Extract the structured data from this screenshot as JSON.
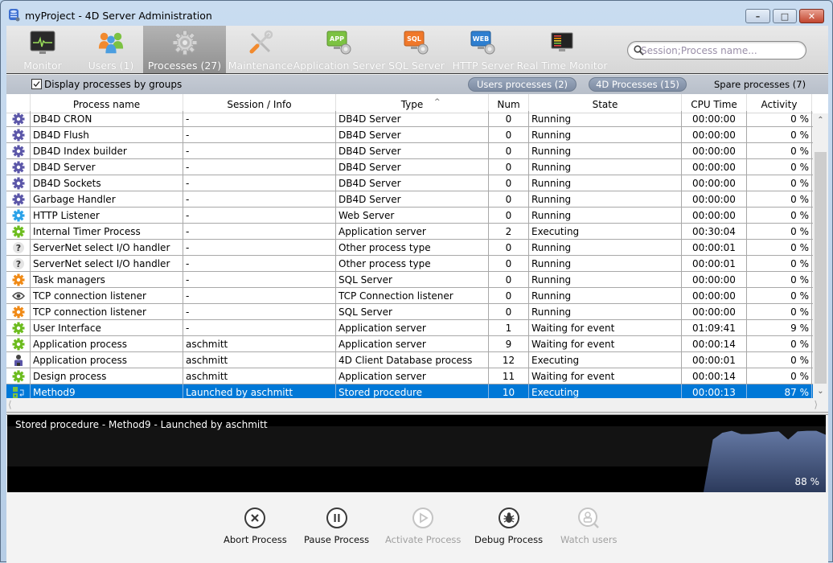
{
  "window": {
    "title": "myProject - 4D Server Administration",
    "controls": {
      "minimize": "–",
      "maximize": "□",
      "close": "✕"
    }
  },
  "toolbar": {
    "items": [
      {
        "id": "monitor",
        "label": "Monitor",
        "icon": "monitor-heartbeat-icon",
        "active": false
      },
      {
        "id": "users",
        "label": "Users (1)",
        "icon": "users-icon",
        "active": false
      },
      {
        "id": "processes",
        "label": "Processes (27)",
        "icon": "gear-icon",
        "active": true
      },
      {
        "id": "maintenance",
        "label": "Maintenance",
        "icon": "wrench-screwdriver-icon",
        "active": false
      },
      {
        "id": "app-server",
        "label": "Application Server",
        "icon": "app-server-icon",
        "active": false
      },
      {
        "id": "sql-server",
        "label": "SQL Server",
        "icon": "sql-server-icon",
        "active": false
      },
      {
        "id": "http-server",
        "label": "HTTP Server",
        "icon": "web-server-icon",
        "active": false
      },
      {
        "id": "rt-monitor",
        "label": "Real Time Monitor",
        "icon": "realtime-monitor-icon",
        "active": false
      }
    ],
    "search": {
      "placeholder": "Session;Process name...",
      "value": ""
    }
  },
  "filters": {
    "group_label": "Display processes by groups",
    "group_checked": true,
    "users_processes": "Users processes (2)",
    "fourd_processes": "4D Processes (15)",
    "spare_processes": "Spare processes (7)"
  },
  "table": {
    "columns": [
      "Process name",
      "Session / Info",
      "Type",
      "Num",
      "State",
      "CPU Time",
      "Activity"
    ],
    "sorted_column": "Session / Info",
    "rows": [
      {
        "icon": "gear-purple",
        "name": "DB4D CRON",
        "session": "-",
        "type": "DB4D Server",
        "num": "0",
        "state": "Running",
        "cpu": "00:00:00",
        "activity": "0 %"
      },
      {
        "icon": "gear-purple",
        "name": "DB4D Flush",
        "session": "-",
        "type": "DB4D Server",
        "num": "0",
        "state": "Running",
        "cpu": "00:00:00",
        "activity": "0 %"
      },
      {
        "icon": "gear-purple",
        "name": "DB4D Index builder",
        "session": "-",
        "type": "DB4D Server",
        "num": "0",
        "state": "Running",
        "cpu": "00:00:00",
        "activity": "0 %"
      },
      {
        "icon": "gear-purple",
        "name": "DB4D Server",
        "session": "-",
        "type": "DB4D Server",
        "num": "0",
        "state": "Running",
        "cpu": "00:00:00",
        "activity": "0 %"
      },
      {
        "icon": "gear-purple",
        "name": "DB4D Sockets",
        "session": "-",
        "type": "DB4D Server",
        "num": "0",
        "state": "Running",
        "cpu": "00:00:00",
        "activity": "0 %"
      },
      {
        "icon": "gear-purple",
        "name": "Garbage Handler",
        "session": "-",
        "type": "DB4D Server",
        "num": "0",
        "state": "Running",
        "cpu": "00:00:00",
        "activity": "0 %"
      },
      {
        "icon": "gear-blue",
        "name": "HTTP Listener",
        "session": "-",
        "type": "Web Server",
        "num": "0",
        "state": "Running",
        "cpu": "00:00:00",
        "activity": "0 %"
      },
      {
        "icon": "gear-green",
        "name": "Internal Timer Process",
        "session": "-",
        "type": "Application server",
        "num": "2",
        "state": "Executing",
        "cpu": "00:30:04",
        "activity": "0 %"
      },
      {
        "icon": "question",
        "name": "ServerNet select I/O handler",
        "session": "-",
        "type": "Other process type",
        "num": "0",
        "state": "Running",
        "cpu": "00:00:01",
        "activity": "0 %"
      },
      {
        "icon": "question",
        "name": "ServerNet select I/O handler",
        "session": "-",
        "type": "Other process type",
        "num": "0",
        "state": "Running",
        "cpu": "00:00:01",
        "activity": "0 %"
      },
      {
        "icon": "gear-orange",
        "name": "Task managers",
        "session": "-",
        "type": "SQL Server",
        "num": "0",
        "state": "Running",
        "cpu": "00:00:00",
        "activity": "0 %"
      },
      {
        "icon": "eye",
        "name": "TCP connection listener",
        "session": "-",
        "type": "TCP Connection listener",
        "num": "0",
        "state": "Running",
        "cpu": "00:00:00",
        "activity": "0 %"
      },
      {
        "icon": "gear-orange",
        "name": "TCP connection listener",
        "session": "-",
        "type": "SQL Server",
        "num": "0",
        "state": "Running",
        "cpu": "00:00:00",
        "activity": "0 %"
      },
      {
        "icon": "gear-green",
        "name": "User Interface",
        "session": "-",
        "type": "Application server",
        "num": "1",
        "state": "Waiting for event",
        "cpu": "01:09:41",
        "activity": "9 %"
      },
      {
        "icon": "gear-green",
        "name": "Application process",
        "session": "aschmitt",
        "type": "Application server",
        "num": "9",
        "state": "Waiting for event",
        "cpu": "00:00:14",
        "activity": "0 %"
      },
      {
        "icon": "user",
        "name": "Application process",
        "session": "aschmitt",
        "type": "4D Client Database process",
        "num": "12",
        "state": "Executing",
        "cpu": "00:00:01",
        "activity": "0 %"
      },
      {
        "icon": "gear-green",
        "name": "Design process",
        "session": "aschmitt",
        "type": "Application server",
        "num": "11",
        "state": "Waiting for event",
        "cpu": "00:00:14",
        "activity": "0 %"
      },
      {
        "icon": "stored-proc",
        "name": "Method9",
        "session": "Launched by aschmitt",
        "type": "Stored procedure",
        "num": "10",
        "state": "Executing",
        "cpu": "00:00:13",
        "activity": "87 %",
        "selected": true
      }
    ]
  },
  "activity_graph": {
    "caption": "Stored procedure - Method9 - Launched by aschmitt",
    "current_value": "88 %",
    "history_percent": [
      0,
      0,
      0,
      0,
      0,
      0,
      0,
      0,
      0,
      0,
      0,
      0,
      0,
      0,
      0,
      0,
      0,
      0,
      0,
      0,
      0,
      0,
      0,
      0,
      0,
      0,
      0,
      0,
      0,
      0,
      0,
      0,
      0,
      0,
      0,
      0,
      0,
      0,
      0,
      0,
      0,
      0,
      0,
      0,
      0,
      0,
      0,
      0,
      0,
      0,
      0,
      0,
      0,
      0,
      0,
      0,
      0,
      0,
      0,
      0,
      0,
      0,
      0,
      0,
      0,
      0,
      0,
      0,
      0,
      0,
      0,
      0,
      0,
      0,
      0,
      78,
      88,
      91,
      86,
      86,
      87,
      89,
      90,
      78,
      90,
      91,
      91,
      85
    ],
    "fill_color": "#5a6f9a"
  },
  "actions": [
    {
      "id": "abort",
      "label": "Abort Process",
      "icon": "abort-x-icon",
      "enabled": true
    },
    {
      "id": "pause",
      "label": "Pause Process",
      "icon": "pause-icon",
      "enabled": true
    },
    {
      "id": "activate",
      "label": "Activate Process",
      "icon": "play-icon",
      "enabled": false
    },
    {
      "id": "debug",
      "label": "Debug Process",
      "icon": "bug-icon",
      "enabled": true
    },
    {
      "id": "watch",
      "label": "Watch users",
      "icon": "watch-user-icon",
      "enabled": false
    }
  ]
}
